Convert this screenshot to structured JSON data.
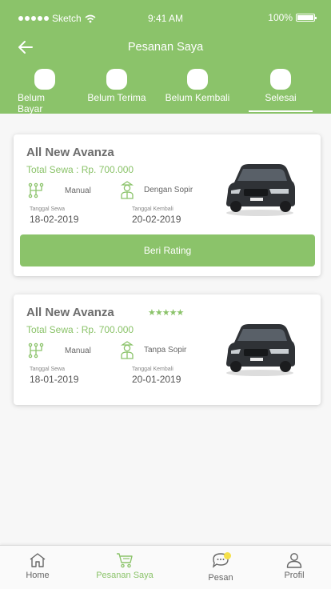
{
  "status_bar": {
    "carrier": "Sketch",
    "time": "9:41 AM",
    "battery": "100%"
  },
  "header": {
    "title": "Pesanan Saya",
    "back_icon": "arrow-left-icon"
  },
  "tabs": [
    {
      "label": "Belum Bayar"
    },
    {
      "label": "Belum Terima"
    },
    {
      "label": "Belum Kembali"
    },
    {
      "label": "Selesai"
    }
  ],
  "orders": [
    {
      "car_name": "All New Avanza",
      "total": "Total Sewa : Rp. 700.000",
      "transmission": "Manual",
      "driver": "Dengan Sopir",
      "rent_date_label": "Tanggal Sewa",
      "rent_date": "18-02-2019",
      "return_date_label": "Tanggal Kembali",
      "return_date": "20-02-2019",
      "action_label": "Beri Rating"
    },
    {
      "car_name": "All New Avanza",
      "rating": 5,
      "stars": "★★★★★",
      "total": "Total Sewa : Rp. 700.000",
      "transmission": "Manual",
      "driver": "Tanpa Sopir",
      "rent_date_label": "Tanggal Sewa",
      "rent_date": "18-01-2019",
      "return_date_label": "Tanggal Kembali",
      "return_date": "20-01-2019"
    }
  ],
  "bottom_nav": [
    {
      "label": "Home",
      "icon": "home-icon"
    },
    {
      "label": "Pesanan Saya",
      "icon": "cart-icon"
    },
    {
      "label": "Pesan",
      "icon": "chat-icon"
    },
    {
      "label": "Profil",
      "icon": "user-icon"
    }
  ],
  "colors": {
    "accent": "#8bc36a",
    "notification": "#f5e04a"
  }
}
